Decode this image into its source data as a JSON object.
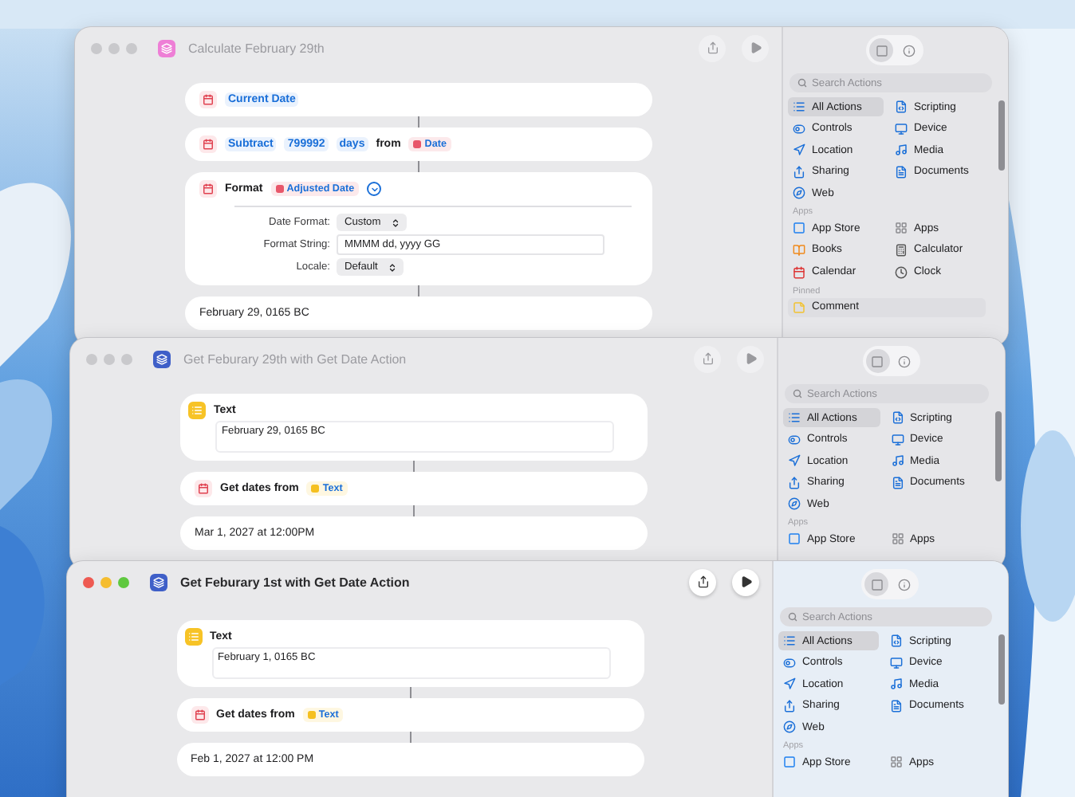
{
  "windows": [
    {
      "title": "Calculate February 29th",
      "active": false,
      "color": "#ee7fd6",
      "actions": [
        {
          "kind": "date",
          "tokens": [
            {
              "kind": "param",
              "text": "Current Date"
            }
          ]
        },
        {
          "kind": "adjust_date",
          "tokens": [
            {
              "kind": "param",
              "text": "Subtract"
            },
            {
              "kind": "param",
              "text": "799992"
            },
            {
              "kind": "param",
              "text": "days"
            },
            {
              "kind": "word",
              "text": "from"
            },
            {
              "kind": "variable",
              "text": "Date",
              "color": "#e8576a"
            }
          ]
        },
        {
          "kind": "format_date",
          "expanded": true,
          "tokens": [
            {
              "kind": "word",
              "text": "Format"
            },
            {
              "kind": "variable",
              "text": "Adjusted Date",
              "color": "#e8576a"
            }
          ],
          "fields": [
            {
              "kind": "popup",
              "label": "Date Format:",
              "value": "Custom"
            },
            {
              "kind": "text",
              "label": "Format String:",
              "value": "MMMM dd, yyyy GG"
            },
            {
              "kind": "popup",
              "label": "Locale:",
              "value": "Default"
            }
          ]
        },
        {
          "kind": "result",
          "value": "February 29, 0165 BC"
        }
      ],
      "sidebar": {
        "tabs": [
          {
            "selected": true
          },
          {
            "selected": false
          }
        ],
        "search": {
          "placeholder": "Search Actions"
        },
        "categories": [
          {
            "label": "All Actions",
            "selected": true
          },
          {
            "label": "Scripting",
            "selected": false
          },
          {
            "label": "Controls",
            "selected": false
          },
          {
            "label": "Device",
            "selected": false
          },
          {
            "label": "Location",
            "selected": false
          },
          {
            "label": "Media",
            "selected": false
          },
          {
            "label": "Sharing",
            "selected": false
          },
          {
            "label": "Documents",
            "selected": false
          },
          {
            "label": "Web",
            "selected": false
          }
        ],
        "sections": [
          {
            "kind": "apps",
            "heading": "Apps",
            "items": [
              {
                "label": "App Store"
              },
              {
                "label": "Apps"
              },
              {
                "label": "Books"
              },
              {
                "label": "Calculator"
              },
              {
                "label": "Calendar"
              },
              {
                "label": "Clock"
              }
            ]
          },
          {
            "kind": "pinned",
            "heading": "Pinned",
            "items": [
              {
                "label": "Comment"
              }
            ]
          }
        ]
      }
    },
    {
      "title": "Get Feburary 29th with Get Date Action",
      "active": false,
      "color": "#3f5fc8",
      "actions": [
        {
          "kind": "text",
          "title": "Text",
          "value": "February 29, 0165 BC"
        },
        {
          "kind": "get_dates",
          "tokens": [
            {
              "kind": "word",
              "text": "Get dates from"
            },
            {
              "kind": "variable",
              "text": "Text",
              "color": "#f5c020"
            }
          ]
        },
        {
          "kind": "result",
          "value": "Mar 1, 2027 at 12:00PM"
        }
      ],
      "sidebar": {
        "tabs": [
          {
            "selected": true
          },
          {
            "selected": false
          }
        ],
        "search": {
          "placeholder": "Search Actions"
        },
        "categories": [
          {
            "label": "All Actions",
            "selected": true
          },
          {
            "label": "Scripting",
            "selected": false
          },
          {
            "label": "Controls",
            "selected": false
          },
          {
            "label": "Device",
            "selected": false
          },
          {
            "label": "Location",
            "selected": false
          },
          {
            "label": "Media",
            "selected": false
          },
          {
            "label": "Sharing",
            "selected": false
          },
          {
            "label": "Documents",
            "selected": false
          },
          {
            "label": "Web",
            "selected": false
          }
        ],
        "sections": [
          {
            "kind": "apps",
            "heading": "Apps",
            "items": [
              {
                "label": "App Store"
              },
              {
                "label": "Apps"
              }
            ]
          }
        ]
      }
    },
    {
      "title": "Get Feburary 1st with Get Date Action",
      "active": true,
      "color": "#3f5fc8",
      "actions": [
        {
          "kind": "text",
          "title": "Text",
          "value": "February 1, 0165 BC"
        },
        {
          "kind": "get_dates",
          "tokens": [
            {
              "kind": "word",
              "text": "Get dates from"
            },
            {
              "kind": "variable",
              "text": "Text",
              "color": "#f5c020"
            }
          ]
        },
        {
          "kind": "result",
          "value": "Feb 1, 2027 at 12:00 PM"
        }
      ],
      "sidebar": {
        "tabs": [
          {
            "selected": true
          },
          {
            "selected": false
          }
        ],
        "search": {
          "placeholder": "Search Actions"
        },
        "categories": [
          {
            "label": "All Actions",
            "selected": true
          },
          {
            "label": "Scripting",
            "selected": false
          },
          {
            "label": "Controls",
            "selected": false
          },
          {
            "label": "Device",
            "selected": false
          },
          {
            "label": "Location",
            "selected": false
          },
          {
            "label": "Media",
            "selected": false
          },
          {
            "label": "Sharing",
            "selected": false
          },
          {
            "label": "Documents",
            "selected": false
          },
          {
            "label": "Web",
            "selected": false
          }
        ],
        "sections": [
          {
            "kind": "apps",
            "heading": "Apps",
            "items": [
              {
                "label": "App Store"
              },
              {
                "label": "Apps"
              }
            ]
          }
        ]
      }
    }
  ]
}
